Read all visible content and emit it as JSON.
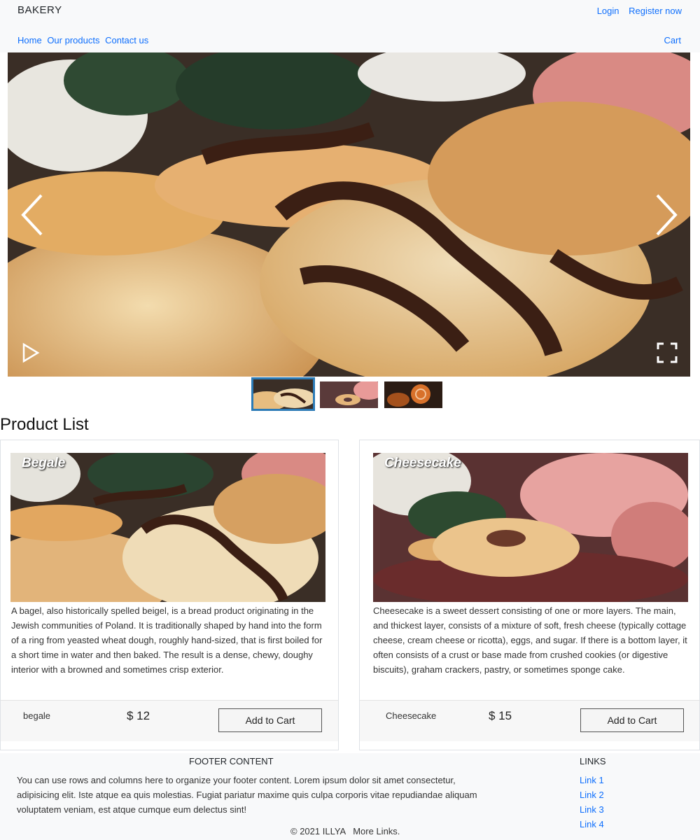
{
  "header": {
    "brand": "BAKERY",
    "auth": [
      "Login",
      "Register now"
    ],
    "nav": [
      "Home",
      "Our products",
      "Contact us"
    ],
    "cart": "Cart"
  },
  "carousel": {
    "thumbnails": 3,
    "active_index": 0
  },
  "product_list": {
    "title": "Product List",
    "products": [
      {
        "image_title": "Begale",
        "description": "A bagel, also historically spelled beigel, is a bread product originating in the Jewish communities of Poland. It is traditionally shaped by hand into the form of a ring from yeasted wheat dough, roughly hand-sized, that is first boiled for a short time in water and then baked. The result is a dense, chewy, doughy interior with a browned and sometimes crisp exterior.",
        "name": "begale",
        "price": "$ 12",
        "button": "Add to Cart"
      },
      {
        "image_title": "Cheesecake",
        "description": "Cheesecake is a sweet dessert consisting of one or more layers. The main, and thickest layer, consists of a mixture of soft, fresh cheese (typically cottage cheese, cream cheese or ricotta), eggs, and sugar. If there is a bottom layer, it often consists of a crust or base made from crushed cookies (or digestive biscuits), graham crackers, pastry, or sometimes sponge cake.",
        "name": "Cheesecake",
        "price": "$ 15",
        "button": "Add to Cart"
      }
    ]
  },
  "footer": {
    "heading": "FOOTER CONTENT",
    "text": "You can use rows and columns here to organize your footer content. Lorem ipsum dolor sit amet consectetur, adipisicing elit. Iste atque ea quis molestias. Fugiat pariatur maxime quis culpa corporis vitae repudiandae aliquam voluptatem veniam, est atque cumque eum delectus sint!",
    "links_heading": "LINKS",
    "links": [
      "Link 1",
      "Link 2",
      "Link 3",
      "Link 4"
    ],
    "copyright": "© 2021 ILLYA",
    "more_links": "More Links."
  },
  "colors": {
    "link": "#0d6efd",
    "header_bg": "#f8f9fa",
    "thumb_active_border": "#2c7bb6"
  },
  "icons": [
    "chevron-left-icon",
    "chevron-right-icon",
    "play-icon",
    "fullscreen-icon"
  ]
}
